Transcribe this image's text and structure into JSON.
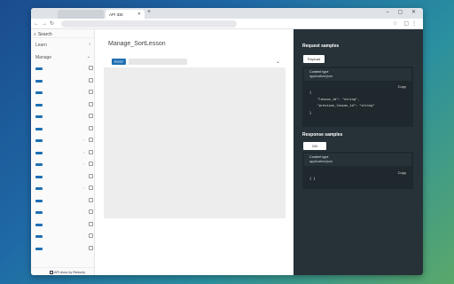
{
  "browser": {
    "active_tab_title": "API IDE",
    "new_tab_symbol": "+",
    "window_controls": "– ▢ ✕"
  },
  "sidebar": {
    "search_label": "Search",
    "groups": [
      {
        "label": "Learn"
      },
      {
        "label": "Manage"
      }
    ],
    "row_count": 16,
    "footer": "API docs by Redocly"
  },
  "operation": {
    "title": "Manage_SortLesson",
    "method": "POST"
  },
  "request_samples": {
    "heading": "Request samples",
    "tab_label": "Payload",
    "content_type_label": "Content type",
    "content_type_value": "application/json",
    "copy_label": "Copy",
    "code_lines": [
      "{",
      "    \"lesson_id\": \"string\",",
      "    \"previous_lesson_id\": \"string\"",
      "}"
    ]
  },
  "response_samples": {
    "heading": "Response samples",
    "tab_label": "200",
    "content_type_label": "Content type",
    "content_type_value": "application/json",
    "copy_label": "Copy",
    "code_lines": [
      "{ }"
    ]
  },
  "colors": {
    "method_badge": "#1f6fb2",
    "right_panel": "#263238",
    "code_box": "#1e282d"
  }
}
